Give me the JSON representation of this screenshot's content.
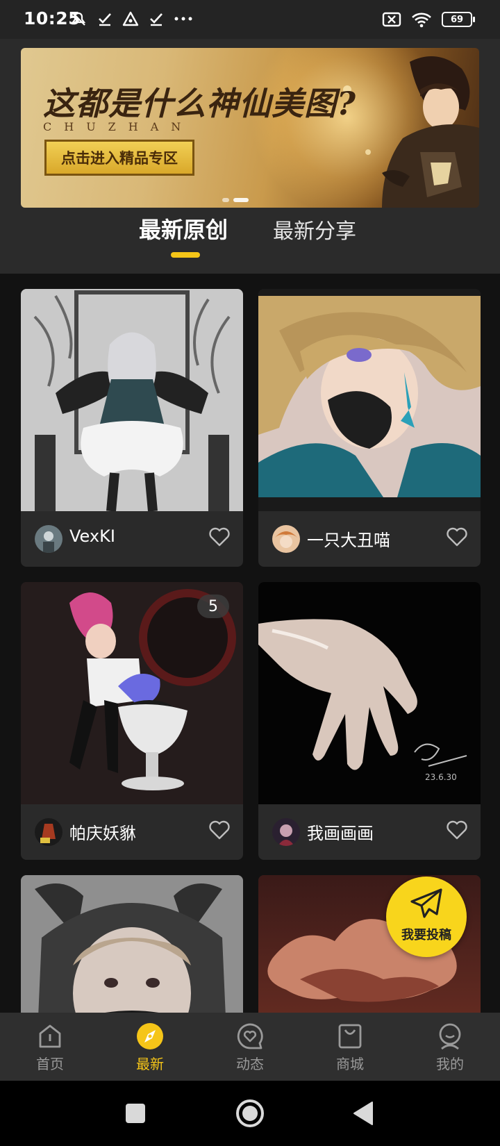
{
  "status_bar": {
    "time": "10:25",
    "battery": "69"
  },
  "banner": {
    "title": "这都是什么神仙美图?",
    "subtitle": "CHUZHAN",
    "cta": "点击进入精品专区"
  },
  "tabs": [
    {
      "label": "最新原创",
      "active": true
    },
    {
      "label": "最新分享",
      "active": false
    }
  ],
  "cards": [
    {
      "user": "VexKI",
      "count": "",
      "image": "gothic-doll-illustration"
    },
    {
      "user": "一只大丑喵",
      "count": "",
      "image": "blonde-boy-illustration"
    },
    {
      "user": "帕庆妖貅",
      "count": "5",
      "image": "figure-photo"
    },
    {
      "user": "我画画画",
      "count": "",
      "image": "hand-painting"
    },
    {
      "user": "",
      "count": "",
      "image": "cosplay-photo"
    },
    {
      "user": "",
      "count": "",
      "image": "sunset-clouds-painting"
    }
  ],
  "fab": {
    "label": "我要投稿",
    "icon": "paper-plane-icon"
  },
  "bottom_nav": [
    {
      "label": "首页",
      "icon": "home-icon",
      "active": false
    },
    {
      "label": "最新",
      "icon": "compass-icon",
      "active": true
    },
    {
      "label": "动态",
      "icon": "heart-bubble-icon",
      "active": false
    },
    {
      "label": "商城",
      "icon": "bag-icon",
      "active": false
    },
    {
      "label": "我的",
      "icon": "profile-icon",
      "active": false
    }
  ],
  "colors": {
    "accent": "#f5c518",
    "fab": "#f8d51c",
    "background": "#121212",
    "card": "#2a2a2a"
  }
}
